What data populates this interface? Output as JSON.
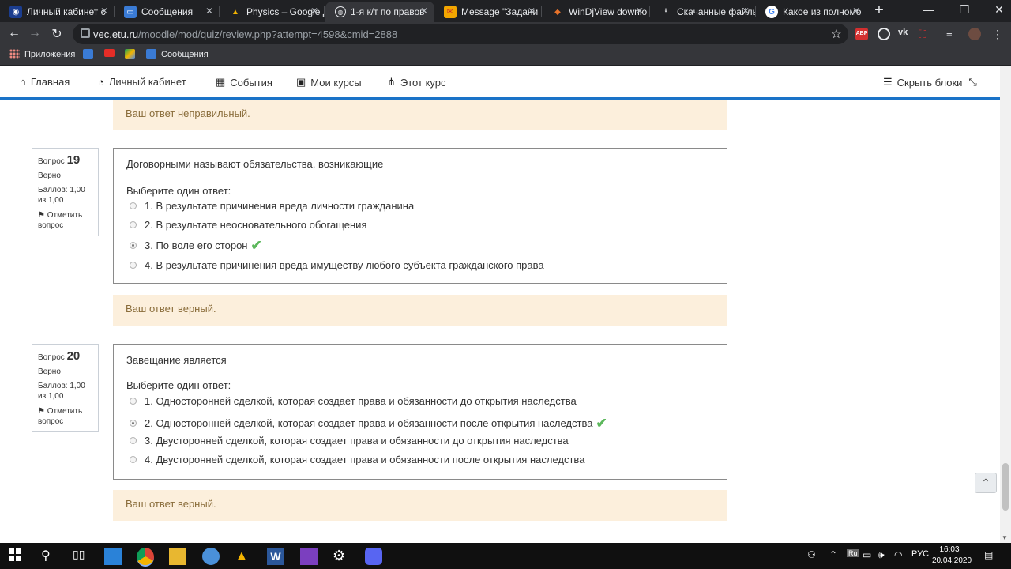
{
  "browser": {
    "tabs": [
      {
        "title": "Личный кабинет с",
        "icon": "etu-icon",
        "active": false
      },
      {
        "title": "Сообщения",
        "icon": "chat-icon",
        "active": false
      },
      {
        "title": "Physics – Google Д",
        "icon": "drive-icon",
        "active": false
      },
      {
        "title": "1-я к/т по правов",
        "icon": "globe-icon",
        "active": true
      },
      {
        "title": "Message \"Задани",
        "icon": "mail-icon",
        "active": false
      },
      {
        "title": "WinDjView downlo",
        "icon": "djview-icon",
        "active": false
      },
      {
        "title": "Скачанные файлы",
        "icon": "download-icon",
        "active": false
      },
      {
        "title": "Какое из полномо",
        "icon": "google-icon",
        "active": false
      }
    ],
    "new_tab": "+",
    "url_host": "vec.etu.ru",
    "url_path": "/moodle/mod/quiz/review.php?attempt=4598&cmid=2888",
    "bookmarks": [
      {
        "label": "Приложения",
        "icon": "apps-icon"
      },
      {
        "label": "",
        "icon": "chat-bookmark-icon"
      },
      {
        "label": "",
        "icon": "youtube-icon"
      },
      {
        "label": "",
        "icon": "drive-bookmark-icon"
      },
      {
        "label": "Сообщения",
        "icon": "chat-icon"
      }
    ]
  },
  "moodle_nav": {
    "home": "Главная",
    "dashboard": "Личный кабинет",
    "events": "События",
    "my_courses": "Мои курсы",
    "this_course": "Этот курс",
    "hide_blocks": "Скрыть блоки"
  },
  "feedback_top": "Ваш ответ неправильный.",
  "questions": [
    {
      "label": "Вопрос",
      "number": "19",
      "state": "Верно",
      "grade": "Баллов: 1,00 из 1,00",
      "flag": "Отметить вопрос",
      "text": "Договорными называют обязательства, возникающие",
      "prompt": "Выберите один ответ:",
      "options": [
        "1. В результате причинения вреда личности гражданина",
        "2. В результате неосновательного обогащения",
        "3. По воле его сторон",
        "4. В результате причинения вреда имуществу любого субъекта гражданского права"
      ],
      "selected_index": 2,
      "feedback": "Ваш ответ верный."
    },
    {
      "label": "Вопрос",
      "number": "20",
      "state": "Верно",
      "grade": "Баллов: 1,00 из 1,00",
      "flag": "Отметить вопрос",
      "text": "Завещание является",
      "prompt": "Выберите один ответ:",
      "options": [
        "1. Односторонней сделкой, которая создает права и обязанности до открытия наследства",
        "2. Односторонней сделкой, которая создает права и обязанности после открытия наследства",
        "3. Двусторонней сделкой, которая создает права и обязанности до открытия наследства",
        "4. Двусторонней сделкой, которая создает права и обязанности после открытия наследства"
      ],
      "selected_index": 1,
      "feedback": "Ваш ответ верный."
    }
  ],
  "taskbar": {
    "language": "РУС",
    "time": "16:03",
    "date": "20.04.2020"
  },
  "colors": {
    "accent": "#1a73c8",
    "feedback_bg": "#fcefdc",
    "feedback_text": "#8a6d3b",
    "correct": "#5cb85c"
  }
}
